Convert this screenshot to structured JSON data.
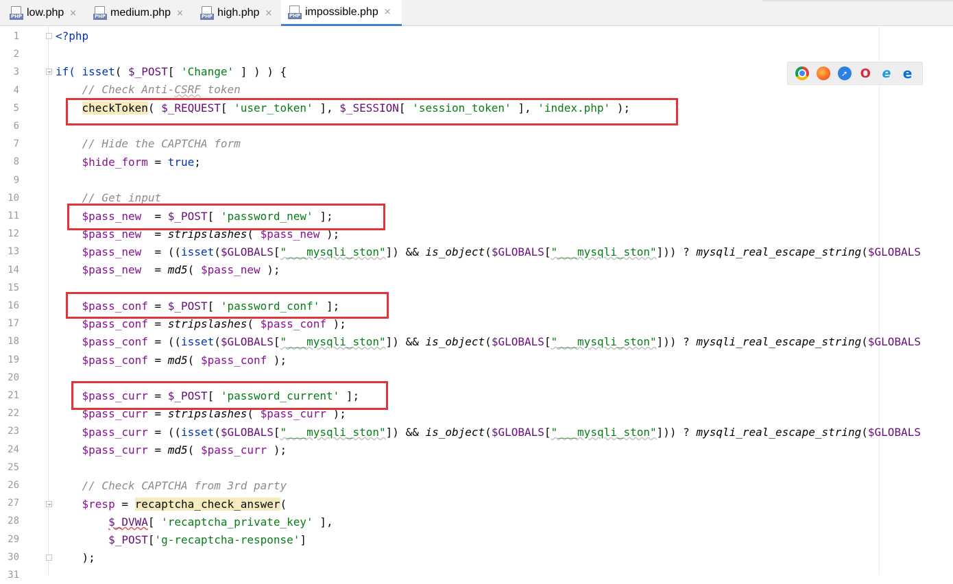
{
  "tabs": [
    {
      "label": "low.php",
      "active": false
    },
    {
      "label": "medium.php",
      "active": false
    },
    {
      "label": "high.php",
      "active": false
    },
    {
      "label": "impossible.php",
      "active": true
    }
  ],
  "file_icon_label": "PHP",
  "close_glyph": "×",
  "line_numbers": [
    "1",
    "2",
    "3",
    "4",
    "5",
    "6",
    "7",
    "8",
    "9",
    "10",
    "11",
    "12",
    "13",
    "14",
    "15",
    "16",
    "17",
    "18",
    "19",
    "20",
    "21",
    "22",
    "23",
    "24",
    "25",
    "26",
    "27",
    "28",
    "29",
    "30",
    "31"
  ],
  "browser_icons": [
    "chrome-icon",
    "firefox-icon",
    "safari-icon",
    "opera-icon",
    "ie-icon",
    "edge-icon"
  ],
  "code": {
    "l1": {
      "a": "<?php"
    },
    "l3": {
      "a": "if(",
      "b": " isset",
      "c": "( ",
      "d": "$_POST",
      "e": "[ ",
      "f": "'Change'",
      "g": " ] ) ) {"
    },
    "l4": {
      "a": "// Check Anti-",
      "b": "CSRF",
      "c": " token"
    },
    "l5": {
      "a": "checkToken",
      "b": "( ",
      "c": "$_REQUEST",
      "d": "[ ",
      "e": "'user_token'",
      "f": " ], ",
      "g": "$_SESSION",
      "h": "[ ",
      "i": "'session_token'",
      "j": " ], ",
      "k": "'index.php'",
      "l": " );"
    },
    "l7": {
      "a": "// Hide the CAPTCHA form"
    },
    "l8": {
      "a": "$hide_form",
      "b": " = ",
      "c": "true",
      "d": ";"
    },
    "l10": {
      "a": "// Get input"
    },
    "l11": {
      "a": "$pass_new",
      "b": "  = ",
      "c": "$_POST",
      "d": "[ ",
      "e": "'password_new'",
      "f": " ];"
    },
    "l12": {
      "a": "$pass_new",
      "b": "  = ",
      "c": "stripslashes",
      "d": "( ",
      "e": "$pass_new",
      "f": " );"
    },
    "l13": {
      "a": "$pass_new",
      "b": "  = ((",
      "c": "isset",
      "d": "(",
      "e": "$GLOBALS",
      "f": "[",
      "g": "\"___mysqli_ston\"",
      "h": "]) && ",
      "i": "is_object",
      "j": "(",
      "k": "$GLOBALS",
      "l": "[",
      "m": "\"___mysqli_ston\"",
      "n": "])) ? ",
      "o": "mysqli_real_escape_string",
      "p": "(",
      "q": "$GLOBALS"
    },
    "l14": {
      "a": "$pass_new",
      "b": "  = ",
      "c": "md5",
      "d": "( ",
      "e": "$pass_new",
      "f": " );"
    },
    "l16": {
      "a": "$pass_conf",
      "b": " = ",
      "c": "$_POST",
      "d": "[ ",
      "e": "'password_conf'",
      "f": " ];"
    },
    "l17": {
      "a": "$pass_conf",
      "b": " = ",
      "c": "stripslashes",
      "d": "( ",
      "e": "$pass_conf",
      "f": " );"
    },
    "l18": {
      "a": "$pass_conf",
      "b": " = ((",
      "c": "isset",
      "d": "(",
      "e": "$GLOBALS",
      "f": "[",
      "g": "\"___mysqli_ston\"",
      "h": "]) && ",
      "i": "is_object",
      "j": "(",
      "k": "$GLOBALS",
      "l": "[",
      "m": "\"___mysqli_ston\"",
      "n": "])) ? ",
      "o": "mysqli_real_escape_string",
      "p": "(",
      "q": "$GLOBALS"
    },
    "l19": {
      "a": "$pass_conf",
      "b": " = ",
      "c": "md5",
      "d": "( ",
      "e": "$pass_conf",
      "f": " );"
    },
    "l21": {
      "a": "$pass_curr",
      "b": " = ",
      "c": "$_POST",
      "d": "[ ",
      "e": "'password_current'",
      "f": " ];"
    },
    "l22": {
      "a": "$pass_curr",
      "b": " = ",
      "c": "stripslashes",
      "d": "( ",
      "e": "$pass_curr",
      "f": " );"
    },
    "l23": {
      "a": "$pass_curr",
      "b": " = ((",
      "c": "isset",
      "d": "(",
      "e": "$GLOBALS",
      "f": "[",
      "g": "\"___mysqli_ston\"",
      "h": "]) && ",
      "i": "is_object",
      "j": "(",
      "k": "$GLOBALS",
      "l": "[",
      "m": "\"___mysqli_ston\"",
      "n": "])) ? ",
      "o": "mysqli_real_escape_string",
      "p": "(",
      "q": "$GLOBALS"
    },
    "l24": {
      "a": "$pass_curr",
      "b": " = ",
      "c": "md5",
      "d": "( ",
      "e": "$pass_curr",
      "f": " );"
    },
    "l26": {
      "a": "// Check CAPTCHA from 3rd party"
    },
    "l27": {
      "a": "$resp",
      "b": " = ",
      "c": "recaptcha_check_answer",
      "d": "("
    },
    "l28": {
      "a": "$_DVWA",
      "b": "[ ",
      "c": "'recaptcha_private_key'",
      "d": " ],"
    },
    "l29": {
      "a": "$_POST",
      "b": "[",
      "c": "'g-recaptcha-response'",
      "d": "]"
    },
    "l30": {
      "a": ");"
    }
  },
  "colors": {
    "keyword": "#0033b3",
    "variable": "#871094",
    "string": "#067d17",
    "comment": "#8c8c8c",
    "highlight_box": "#e0333a",
    "active_tab_underline": "#4083c9"
  }
}
